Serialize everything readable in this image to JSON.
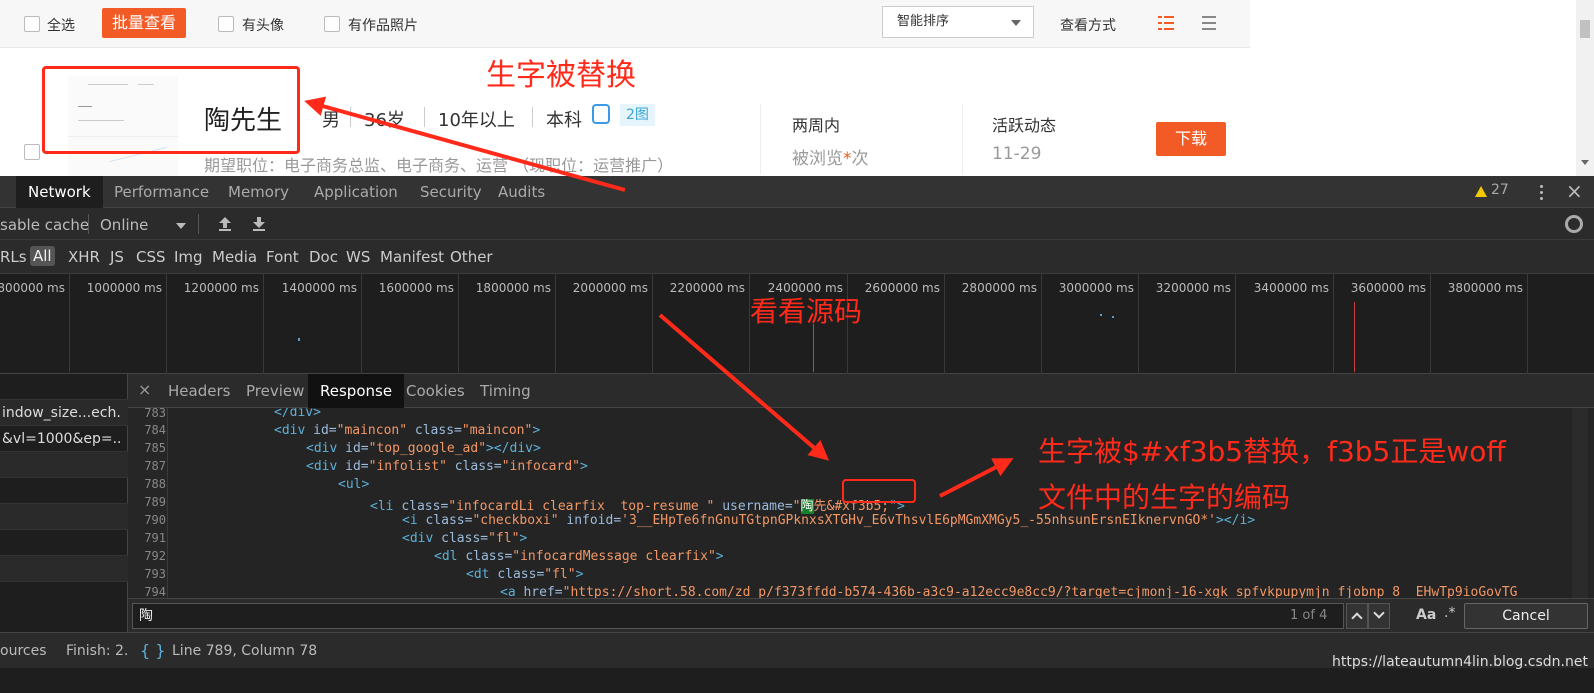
{
  "webpage": {
    "select_all": "全选",
    "batch_view": "批量查看",
    "has_avatar": "有头像",
    "has_work_photos": "有作品照片",
    "sort": "智能排序",
    "view_mode": "查看方式",
    "resume": {
      "name": "陶先生",
      "gender": "男",
      "age": "36岁",
      "experience": "10年以上",
      "education": "本科",
      "image_badge": "2图",
      "expected": "期望职位：电子商务总监、电子商务、运营 （现职位：运营推广）",
      "two_weeks": "两周内",
      "viewed_prefix": "被浏览",
      "viewed_star": "*",
      "viewed_suffix": "次",
      "activity": "活跃动态",
      "activity_date": "11-29",
      "download": "下载"
    }
  },
  "devtools": {
    "tabs": [
      "Network",
      "Performance",
      "Memory",
      "Application",
      "Security",
      "Audits"
    ],
    "warnings": "27",
    "disable_cache": "sable cache",
    "throttle": "Online",
    "filters": [
      "RLs",
      "All",
      "XHR",
      "JS",
      "CSS",
      "Img",
      "Media",
      "Font",
      "Doc",
      "WS",
      "Manifest",
      "Other"
    ],
    "timeline_ticks": [
      "800000 ms",
      "1000000 ms",
      "1200000 ms",
      "1400000 ms",
      "1600000 ms",
      "1800000 ms",
      "2000000 ms",
      "2200000 ms",
      "2400000 ms",
      "2600000 ms",
      "2800000 ms",
      "3000000 ms",
      "3200000 ms",
      "3400000 ms",
      "3600000 ms",
      "3800000 ms",
      "40"
    ],
    "requests": [
      "",
      "indow_size...ech.",
      "&vl=1000&ep=..",
      "",
      "",
      "",
      "",
      ""
    ],
    "detail_tabs": [
      "Headers",
      "Preview",
      "Response",
      "Cookies",
      "Timing"
    ],
    "line_numbers": [
      "783",
      "784",
      "785",
      "787",
      "788",
      "789",
      "790",
      "791",
      "792",
      "793",
      "794"
    ],
    "code": {
      "l783": "</div>",
      "l784_tag": "<div ",
      "l784_a1": "id=",
      "l784_v1": "\"maincon\"",
      "l784_a2": " class=",
      "l784_v2": "\"maincon\"",
      "l784_end": ">",
      "l785_tag": "<div ",
      "l785_a1": "id=",
      "l785_v1": "\"top_google_ad\"",
      "l785_end": "></div>",
      "l787_tag": "<div ",
      "l787_a1": "id=",
      "l787_v1": "\"infolist\"",
      "l787_a2": " class=",
      "l787_v2": "\"infocard\"",
      "l787_end": ">",
      "l788": "<ul>",
      "l789_tag": "<li ",
      "l789_a1": "class=",
      "l789_v1": "\"infocardLi clearfix  top-resume \"",
      "l789_a2": " username=",
      "l789_q": "\"",
      "l789_hl": "陶",
      "l789_rest": "先&#xf3b5;",
      "l789_end": "\">",
      "l790_tag": "<i ",
      "l790_a1": "class=",
      "l790_v1": "\"checkboxi\"",
      "l790_a2": " infoid=",
      "l790_v2": "'3__EHpTe6fnGnuTGtpnGPknxsXTGHv_E6vThsvlE6pMGmXMGy5_-55nhsunErsnEIknervnGO*'",
      "l790_end": "></i>",
      "l791_tag": "<div ",
      "l791_a1": "class=",
      "l791_v1": "\"fl\"",
      "l791_end": ">",
      "l792_tag": "<dl ",
      "l792_a1": "class=",
      "l792_v1": "\"infocardMessage clearfix\"",
      "l792_end": ">",
      "l793_tag": "<dt ",
      "l793_a1": "class=",
      "l793_v1": "\"fl\"",
      "l793_end": ">",
      "l794_tag": "<a ",
      "l794_a1": "href=",
      "l794_v1": "\"https://short.58.com/zd_p/f373ffdd-b574-436b-a3c9-a12ecc9e8cc9/?target=cjmonj-16-xgk_spfvkpupymjn_fjobnp_8__EHwTp9ioGovTG"
    },
    "search_value": "陶",
    "search_count": "1 of 4",
    "match_case": "Aa",
    "regex": ".*",
    "cancel": "Cancel",
    "status_left": "ources",
    "status_finish": "Finish: 2.",
    "status_braces": "{ }",
    "cursor_position": "Line 789, Column 78"
  },
  "annotations": {
    "replaced": "生字被替换",
    "view_source": "看看源码",
    "detail_line1": "生字被$#xf3b5替换，f3b5正是woff",
    "detail_line2": "文件中的生字的编码"
  },
  "watermark": "https://lateautumn4lin.blog.csdn.net"
}
